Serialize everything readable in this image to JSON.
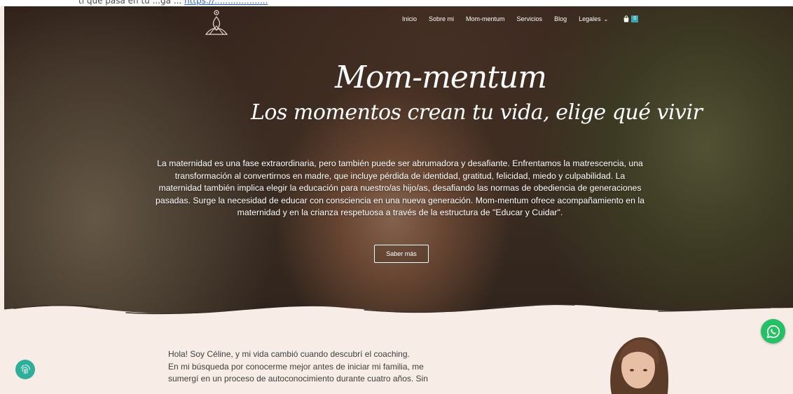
{
  "topbar": {
    "message_prefix": "ti que pasa en tu ...ga   ...",
    "link_text": "https://...................."
  },
  "nav": {
    "items": [
      {
        "label": "Inicio"
      },
      {
        "label": "Sobre mi"
      },
      {
        "label": "Mom-mentum"
      },
      {
        "label": "Servicios"
      },
      {
        "label": "Blog"
      },
      {
        "label": "Legales"
      }
    ],
    "cart_count": "0"
  },
  "hero": {
    "title": "Mom-mentum",
    "subtitle": "Los momentos crean tu vida, elige qué vivir",
    "body": "La maternidad es una fase extraordinaria, pero también puede ser abrumadora y desafiante. Enfrentamos la matrescencia, una transformación al convertirnos en madre, que incluye pérdida de identidad, gratitud, felicidad, miedo y culpabilidad. La maternidad también implica elegir la educación para nuestro/as hijo/as, desafiando las normas de obediencia de generaciones pasadas. Surge la necesidad de educar con consciencia en una nueva generación. Mom-mentum ofrece acompañamiento en la maternidad y en la crianza respetuosa a través de la estructura de \"Educar y Cuidar\".",
    "button_label": "Saber más"
  },
  "intro": {
    "line1": "Hola! Soy Céline, y mi vida cambió cuando descubrí el coaching.",
    "line2": "En mi búsqueda por conocerme mejor antes de iniciar mi familia, me",
    "line3": "sumergí en un proceso de autoconocimiento durante cuatro años. Sin"
  },
  "colors": {
    "accent": "#3aa6b5",
    "whatsapp": "#25c064",
    "section_bg": "#f8ede6"
  },
  "icons": {
    "logo": "lotus-figure-logo",
    "cart": "shopping-bag-icon",
    "whatsapp": "whatsapp-icon",
    "cookie": "fingerprint-icon"
  }
}
